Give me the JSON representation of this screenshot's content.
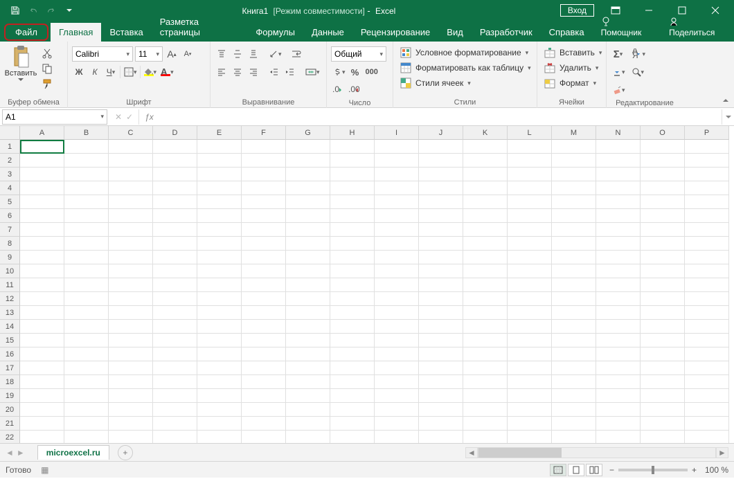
{
  "title": {
    "doc": "Книга1",
    "mode": "[Режим совместимости]",
    "app": "Excel",
    "signin": "Вход"
  },
  "tabs": {
    "file": "Файл",
    "home": "Главная",
    "insert": "Вставка",
    "layout": "Разметка страницы",
    "formulas": "Формулы",
    "data": "Данные",
    "review": "Рецензирование",
    "view": "Вид",
    "dev": "Разработчик",
    "help": "Справка",
    "tellme": "Помощник",
    "share": "Поделиться"
  },
  "ribbon": {
    "clipboard": {
      "label": "Буфер обмена",
      "paste": "Вставить"
    },
    "font": {
      "label": "Шрифт",
      "name": "Calibri",
      "size": "11"
    },
    "align": {
      "label": "Выравнивание"
    },
    "number": {
      "label": "Число",
      "format": "Общий"
    },
    "styles": {
      "label": "Стили",
      "cond": "Условное форматирование",
      "table": "Форматировать как таблицу",
      "cell": "Стили ячеек"
    },
    "cells": {
      "label": "Ячейки",
      "insert": "Вставить",
      "delete": "Удалить",
      "format": "Формат"
    },
    "editing": {
      "label": "Редактирование"
    }
  },
  "namebox": "A1",
  "columns": [
    "A",
    "B",
    "C",
    "D",
    "E",
    "F",
    "G",
    "H",
    "I",
    "J",
    "K",
    "L",
    "M",
    "N",
    "O",
    "P"
  ],
  "rows": [
    "1",
    "2",
    "3",
    "4",
    "5",
    "6",
    "7",
    "8",
    "9",
    "10",
    "11",
    "12",
    "13",
    "14",
    "15",
    "16",
    "17",
    "18",
    "19",
    "20",
    "21",
    "22"
  ],
  "sheet": {
    "tab": "microexcel.ru"
  },
  "status": {
    "ready": "Готово",
    "zoom": "100 %"
  }
}
